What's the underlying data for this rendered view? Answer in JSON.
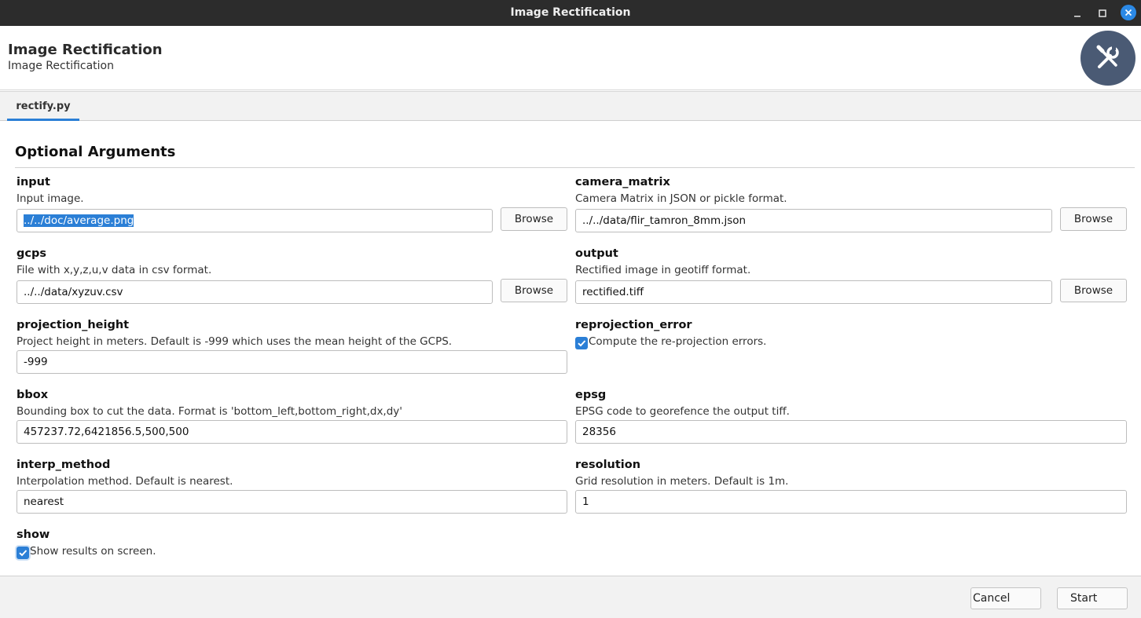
{
  "window": {
    "title": "Image Rectification"
  },
  "header": {
    "title": "Image Rectification",
    "subtitle": "Image Rectification"
  },
  "tabs": [
    {
      "label": "rectify.py",
      "active": true
    }
  ],
  "section": {
    "title": "Optional Arguments"
  },
  "args": {
    "input": {
      "name": "input",
      "desc": "Input image.",
      "value": "../../doc/average.png",
      "browse": "Browse"
    },
    "camera_matrix": {
      "name": "camera_matrix",
      "desc": "Camera Matrix in JSON or pickle format.",
      "value": "../../data/flir_tamron_8mm.json",
      "browse": "Browse"
    },
    "gcps": {
      "name": "gcps",
      "desc": "File with x,y,z,u,v data in csv format.",
      "value": "../../data/xyzuv.csv",
      "browse": "Browse"
    },
    "output": {
      "name": "output",
      "desc": "Rectified image in geotiff format.",
      "value": "rectified.tiff",
      "browse": "Browse"
    },
    "projection_height": {
      "name": "projection_height",
      "desc": "Project height in meters. Default is -999 which uses the mean height of the GCPS.",
      "value": "-999"
    },
    "reprojection_error": {
      "name": "reprojection_error",
      "checkbox_label": "Compute the re-projection errors.",
      "checked": true
    },
    "bbox": {
      "name": "bbox",
      "desc": "Bounding box to cut the data. Format is 'bottom_left,bottom_right,dx,dy'",
      "value": "457237.72,6421856.5,500,500"
    },
    "epsg": {
      "name": "epsg",
      "desc": "EPSG code to georefence the output tiff.",
      "value": "28356"
    },
    "interp_method": {
      "name": "interp_method",
      "desc": "Interpolation method. Default is nearest.",
      "value": "nearest"
    },
    "resolution": {
      "name": "resolution",
      "desc": "Grid resolution in meters. Default is 1m.",
      "value": "1"
    },
    "show": {
      "name": "show",
      "checkbox_label": "Show results on screen.",
      "checked": true
    }
  },
  "footer": {
    "cancel_label": "Cancel",
    "start_label": "Start"
  },
  "colors": {
    "accent": "#2b7fd6",
    "titlebar": "#2c2c2c",
    "logo_bg": "#4a5a74"
  },
  "icons": {
    "logo": "tools-icon",
    "minimize": "minimize-icon",
    "maximize": "maximize-icon",
    "close": "close-icon",
    "check": "check-icon"
  }
}
